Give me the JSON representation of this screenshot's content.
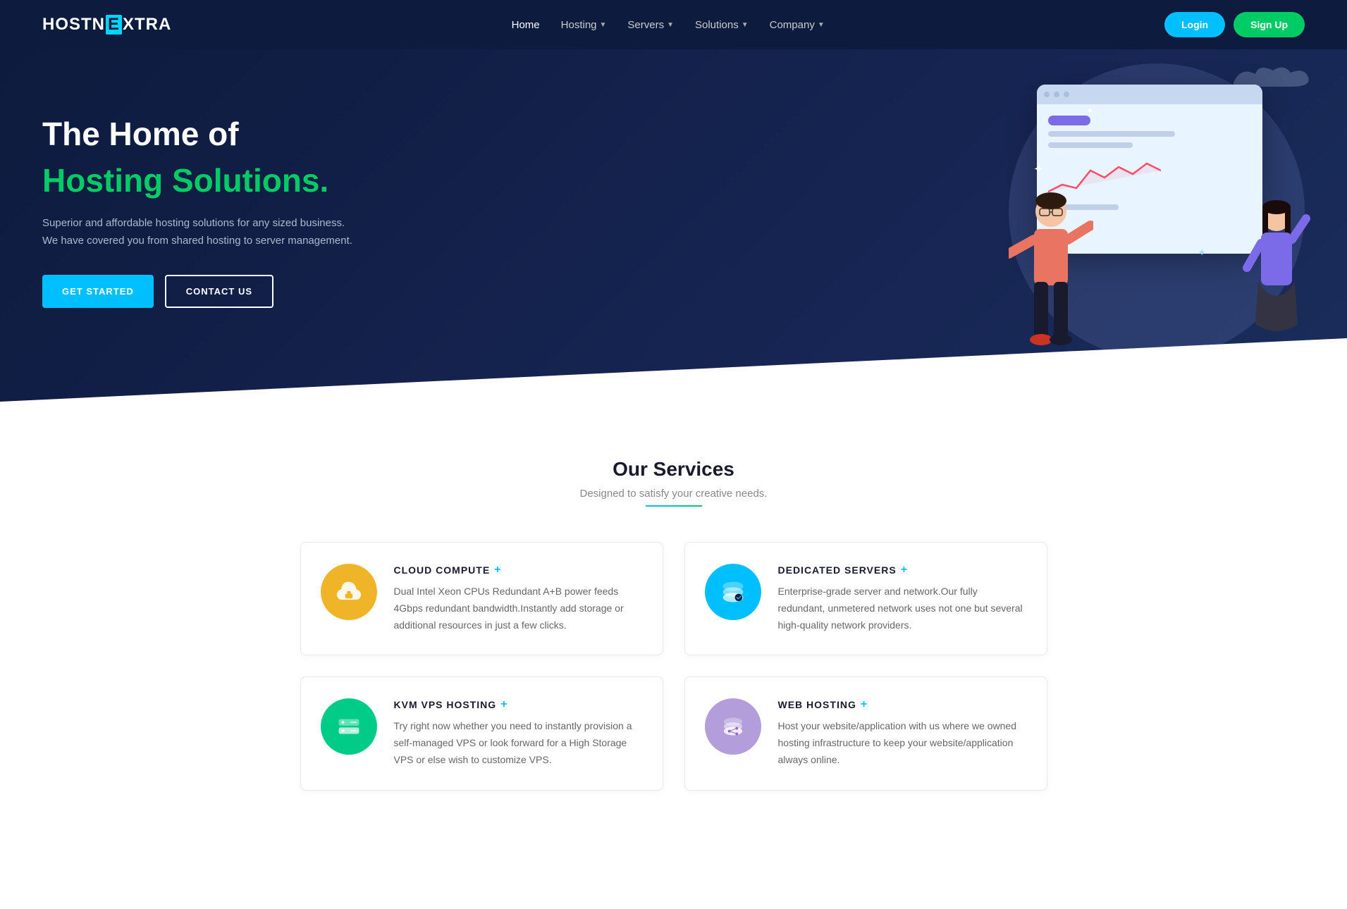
{
  "navbar": {
    "logo_text_1": "HOSTN",
    "logo_text_2": "XTRA",
    "logo_box": "E",
    "nav_links": [
      {
        "label": "Home",
        "active": true,
        "has_dropdown": false
      },
      {
        "label": "Hosting",
        "active": false,
        "has_dropdown": true
      },
      {
        "label": "Servers",
        "active": false,
        "has_dropdown": true
      },
      {
        "label": "Solutions",
        "active": false,
        "has_dropdown": true
      },
      {
        "label": "Company",
        "active": false,
        "has_dropdown": true
      }
    ],
    "login_label": "Login",
    "signup_label": "Sign Up"
  },
  "hero": {
    "title_line1": "The Home of",
    "title_line2": "Hosting Solutions.",
    "description": "Superior and affordable hosting solutions for any sized business. We have covered you from shared hosting to server management.",
    "btn_get_started": "GET STARTED",
    "btn_contact": "CONTACT US"
  },
  "services": {
    "section_title": "Our Services",
    "section_subtitle": "Designed to satisfy your creative needs.",
    "cards": [
      {
        "id": "cloud-compute",
        "title": "CLOUD COMPUTE",
        "icon_type": "cloud",
        "icon_color": "yellow",
        "description": "Dual Intel Xeon CPUs Redundant A+B power feeds 4Gbps redundant bandwidth.Instantly add storage or additional resources in just a few clicks."
      },
      {
        "id": "dedicated-servers",
        "title": "DEDICATED SERVERS",
        "icon_type": "server",
        "icon_color": "blue",
        "description": "Enterprise-grade server and network.Our fully redundant, unmetered network uses not one but several high-quality network providers."
      },
      {
        "id": "kvm-vps",
        "title": "KVM VPS HOSTING",
        "icon_type": "vps",
        "icon_color": "green",
        "description": "Try right now whether you need to instantly provision a self-managed VPS or look forward for a High Storage VPS or else wish to customize VPS."
      },
      {
        "id": "web-hosting",
        "title": "WEB HOSTING",
        "icon_type": "web",
        "icon_color": "purple",
        "description": "Host your website/application with us where we owned hosting infrastructure to keep your website/application always online."
      }
    ]
  }
}
